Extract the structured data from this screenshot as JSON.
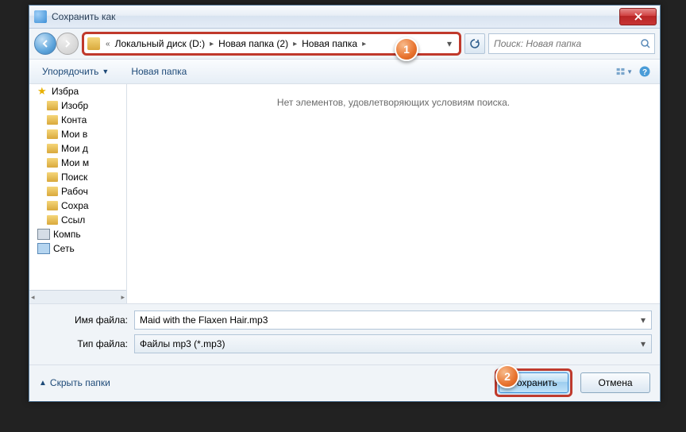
{
  "title": "Сохранить как",
  "breadcrumbs": {
    "prefix": "«",
    "items": [
      "Локальный диск (D:)",
      "Новая папка (2)",
      "Новая папка"
    ]
  },
  "search": {
    "placeholder": "Поиск: Новая папка"
  },
  "toolbar": {
    "organize": "Упорядочить",
    "new_folder": "Новая папка"
  },
  "tree": {
    "favorites": "Избра",
    "items": [
      "Изобр",
      "Конта",
      "Мои в",
      "Мои д",
      "Мои м",
      "Поиск",
      "Рабоч",
      "Сохра",
      "Ссыл"
    ],
    "computer": "Компь",
    "network": "Сеть"
  },
  "content": {
    "empty": "Нет элементов, удовлетворяющих условиям поиска."
  },
  "fields": {
    "filename_label": "Имя файла:",
    "filename_value": "Maid with the Flaxen Hair.mp3",
    "filetype_label": "Тип файла:",
    "filetype_value": "Файлы mp3 (*.mp3)"
  },
  "footer": {
    "hide": "Скрыть папки",
    "save": "Сохранить",
    "cancel": "Отмена"
  },
  "callouts": {
    "one": "1",
    "two": "2"
  }
}
